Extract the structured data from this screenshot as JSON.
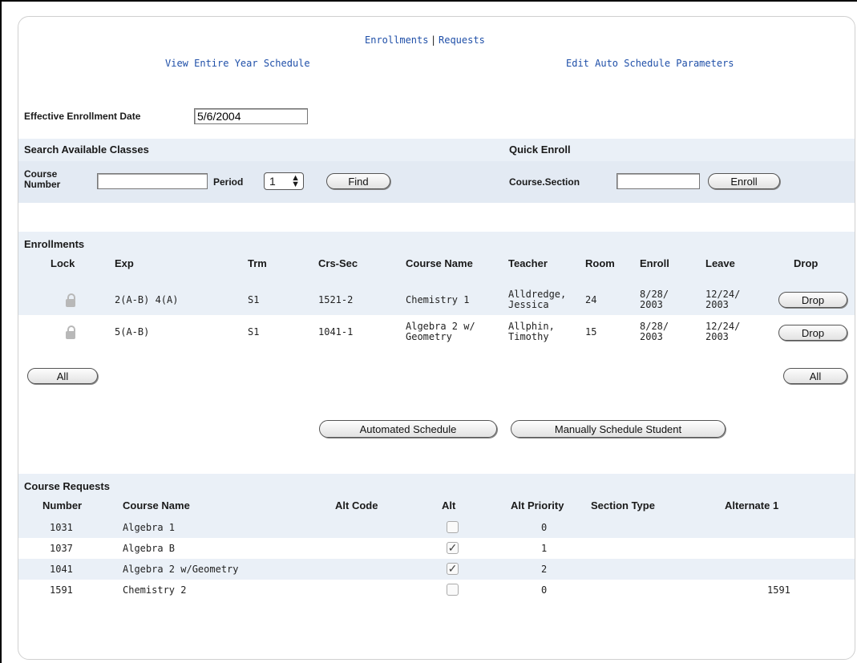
{
  "nav": {
    "enrollments_link": "Enrollments",
    "separator": "|",
    "requests_link": "Requests",
    "view_year_link": "View Entire Year Schedule",
    "edit_auto_link": "Edit Auto Schedule Parameters"
  },
  "effective_date": {
    "label": "Effective Enrollment Date",
    "value": "5/6/2004"
  },
  "search": {
    "title": "Search Available Classes",
    "course_label_1": "Course",
    "course_label_2": "Number",
    "course_value": "",
    "period_label": "Period",
    "period_value": "1",
    "find_button": "Find"
  },
  "quick_enroll": {
    "title": "Quick Enroll",
    "section_label": "Course.Section",
    "section_value": "",
    "enroll_button": "Enroll"
  },
  "enrollments": {
    "title": "Enrollments",
    "headers": [
      "Lock",
      "Exp",
      "Trm",
      "Crs-Sec",
      "Course Name",
      "Teacher",
      "Room",
      "Enroll",
      "Leave",
      "Drop"
    ],
    "rows": [
      {
        "exp": "2(A-B) 4(A)",
        "trm": "S1",
        "crs_sec": "1521-2",
        "course_name": "Chemistry 1",
        "course_name_2": "",
        "teacher_1": "Alldredge,",
        "teacher_2": "Jessica",
        "room": "24",
        "enroll_1": "8/28/",
        "enroll_2": "2003",
        "leave_1": "12/24/",
        "leave_2": "2003",
        "drop": "Drop"
      },
      {
        "exp": "5(A-B)",
        "trm": "S1",
        "crs_sec": "1041-1",
        "course_name": "Algebra 2 w/",
        "course_name_2": "Geometry",
        "teacher_1": "Allphin,",
        "teacher_2": "Timothy",
        "room": "15",
        "enroll_1": "8/28/",
        "enroll_2": "2003",
        "leave_1": "12/24/",
        "leave_2": "2003",
        "drop": "Drop"
      }
    ],
    "all_left": "All",
    "all_right": "All",
    "automated_button": "Automated Schedule",
    "manual_button": "Manually Schedule Student"
  },
  "requests": {
    "title": "Course Requests",
    "headers": [
      "Number",
      "Course Name",
      "Alt Code",
      "Alt",
      "Alt Priority",
      "Section Type",
      "Alternate 1"
    ],
    "rows": [
      {
        "number": "1031",
        "course_name": "Algebra 1",
        "alt_checked": false,
        "alt_priority": "0",
        "alternate_1": ""
      },
      {
        "number": "1037",
        "course_name": "Algebra B",
        "alt_checked": true,
        "alt_priority": "1",
        "alternate_1": ""
      },
      {
        "number": "1041",
        "course_name": "Algebra 2 w/Geometry",
        "alt_checked": true,
        "alt_priority": "2",
        "alternate_1": ""
      },
      {
        "number": "1591",
        "course_name": "Chemistry 2",
        "alt_checked": false,
        "alt_priority": "0",
        "alternate_1": "1591"
      }
    ]
  },
  "colors": {
    "band": "#eaf0f7",
    "link": "#1f4fa8"
  },
  "icons": {
    "lock": "lock-icon",
    "check": "checkmark-icon"
  }
}
